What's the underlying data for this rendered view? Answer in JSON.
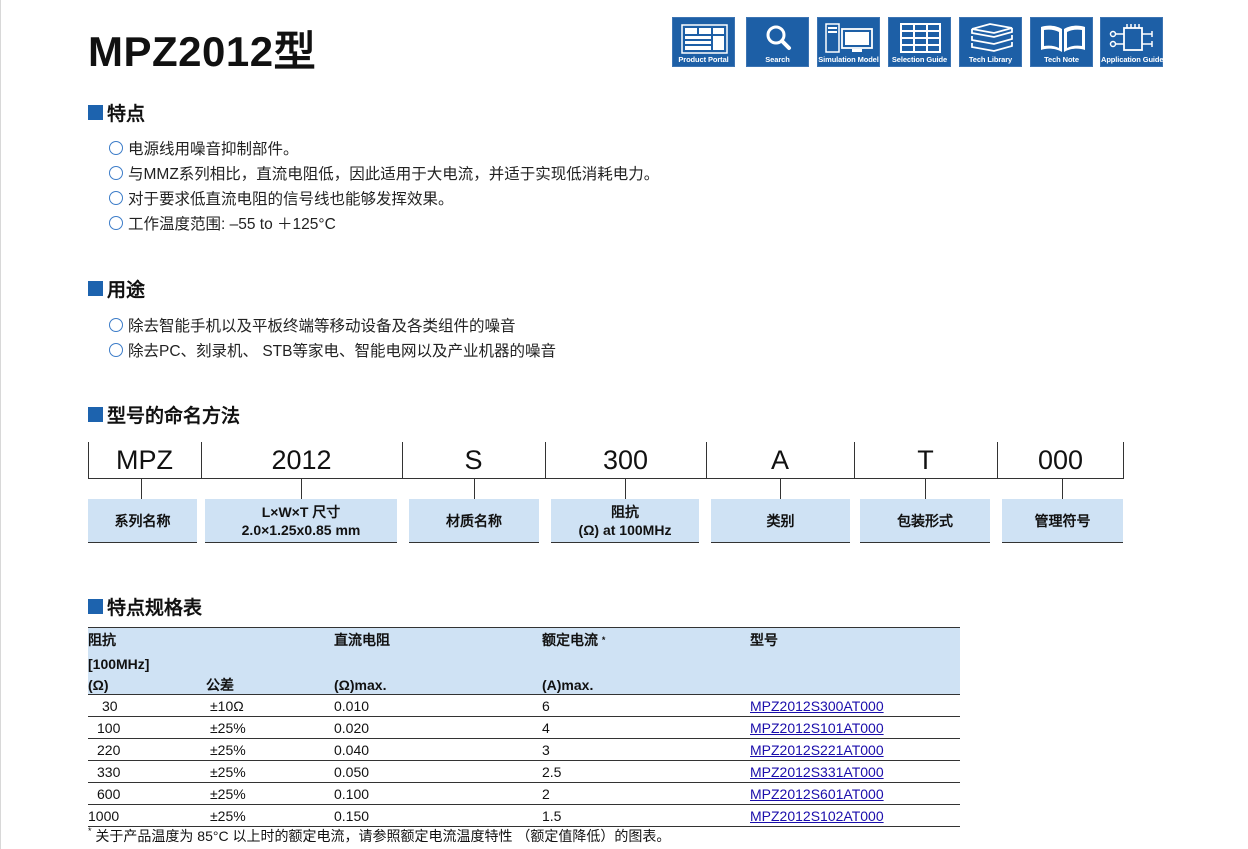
{
  "title": "MPZ2012型",
  "top_icons": [
    {
      "label": "Product Portal",
      "icon": "product-portal-icon"
    },
    {
      "label": "Search",
      "icon": "search-icon"
    },
    {
      "label": "Simulation Model",
      "icon": "simulation-model-icon"
    },
    {
      "label": "Selection Guide",
      "icon": "selection-guide-icon"
    },
    {
      "label": "Tech Library",
      "icon": "tech-library-icon"
    },
    {
      "label": "Tech Note",
      "icon": "tech-note-icon"
    },
    {
      "label": "Application Guides",
      "icon": "application-guides-icon"
    }
  ],
  "features": {
    "heading": "特点",
    "items": [
      "电源线用噪音抑制部件。",
      "与MMZ系列相比，直流电阻低，因此适用于大电流，并适于实现低消耗电力。",
      "对于要求低直流电阻的信号线也能够发挥效果。",
      "工作温度范围: –55 to ＋125°C"
    ]
  },
  "applications": {
    "heading": "用途",
    "items": [
      "除去智能手机以及平板终端等移动设备及各类组件的噪音",
      "除去PC、刻录机、 STB等家电、智能电网以及产业机器的噪音"
    ]
  },
  "naming": {
    "heading": "型号的命名方法",
    "codes": [
      "MPZ",
      "2012",
      "S",
      "300",
      "A",
      "T",
      "000"
    ],
    "labels": [
      [
        "系列名称"
      ],
      [
        "L×W×T 尺寸",
        "2.0×1.25x0.85 mm"
      ],
      [
        "材质名称"
      ],
      [
        "阻抗",
        "(Ω) at 100MHz"
      ],
      [
        "类别"
      ],
      [
        "包装形式"
      ],
      [
        "管理符号"
      ]
    ]
  },
  "spec": {
    "heading": "特点规格表",
    "header": {
      "impedance": [
        "阻抗",
        "[100MHz]",
        "(Ω)"
      ],
      "tolerance": "公差",
      "dcr": [
        "直流电阻",
        "(Ω)max."
      ],
      "current": [
        "额定电流",
        "(A)max."
      ],
      "current_mark": "*",
      "part": "型号"
    },
    "rows": [
      {
        "impedance": "30",
        "tolerance": "±10Ω",
        "dcr": "0.010",
        "current": "6",
        "part": "MPZ2012S300AT000"
      },
      {
        "impedance": "100",
        "tolerance": "±25%",
        "dcr": "0.020",
        "current": "4",
        "part": "MPZ2012S101AT000"
      },
      {
        "impedance": "220",
        "tolerance": "±25%",
        "dcr": "0.040",
        "current": "3",
        "part": "MPZ2012S221AT000"
      },
      {
        "impedance": "330",
        "tolerance": "±25%",
        "dcr": "0.050",
        "current": "2.5",
        "part": "MPZ2012S331AT000"
      },
      {
        "impedance": "600",
        "tolerance": "±25%",
        "dcr": "0.100",
        "current": "2",
        "part": "MPZ2012S601AT000"
      },
      {
        "impedance": "1000",
        "tolerance": "±25%",
        "dcr": "0.150",
        "current": "1.5",
        "part": "MPZ2012S102AT000"
      }
    ],
    "footnote_mark": "*",
    "footnote": "关于产品温度为 85°C 以上时的额定电流，请参照额定电流温度特性 （额定值降低）的图表。"
  }
}
